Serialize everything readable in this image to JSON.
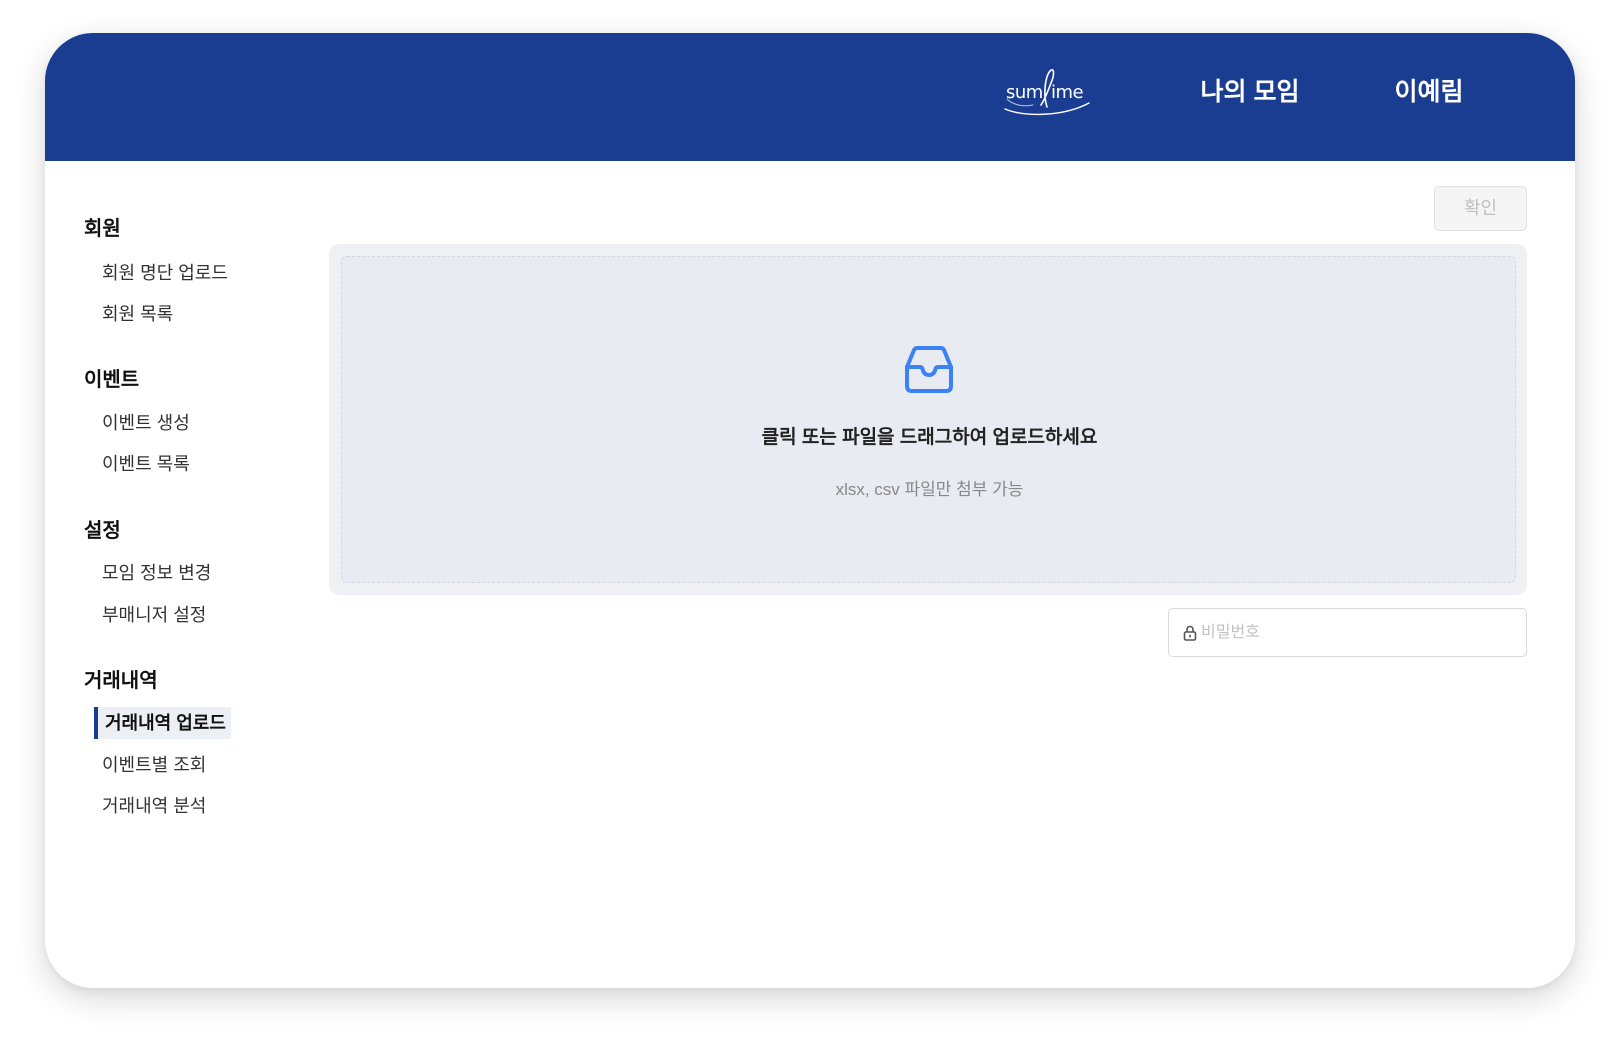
{
  "header": {
    "logo": {
      "prefix": "sum",
      "suffix": "ime"
    },
    "nav": [
      {
        "label": "나의 모임"
      },
      {
        "label": "이예림"
      }
    ]
  },
  "sidebar": {
    "sections": [
      {
        "title": "회원",
        "items": [
          {
            "label": "회원 명단 업로드"
          },
          {
            "label": "회원 목록"
          }
        ]
      },
      {
        "title": "이벤트",
        "items": [
          {
            "label": "이벤트 생성"
          },
          {
            "label": "이벤트 목록"
          }
        ]
      },
      {
        "title": "설정",
        "items": [
          {
            "label": "모임 정보 변경"
          },
          {
            "label": "부매니저 설정"
          }
        ]
      },
      {
        "title": "거래내역",
        "items": [
          {
            "label": "거래내역 업로드"
          },
          {
            "label": "이벤트별 조회"
          },
          {
            "label": "거래내역 분석"
          }
        ]
      }
    ],
    "active_item": "거래내역 업로드"
  },
  "toolbar": {
    "confirm_label": "확인"
  },
  "upload": {
    "icon": "inbox-icon",
    "title": "클릭 또는 파일을 드래그하여 업로드하세요",
    "hint": "xlsx, csv 파일만 첨부 가능"
  },
  "password": {
    "icon": "lock-icon",
    "placeholder": "비밀번호",
    "value": ""
  },
  "colors": {
    "header_bg": "#1a3d91",
    "accent": "#3b82f6",
    "active_bar": "#1a3d91",
    "active_bg": "#eceff3",
    "dropzone_bg": "#e8ebf1"
  }
}
